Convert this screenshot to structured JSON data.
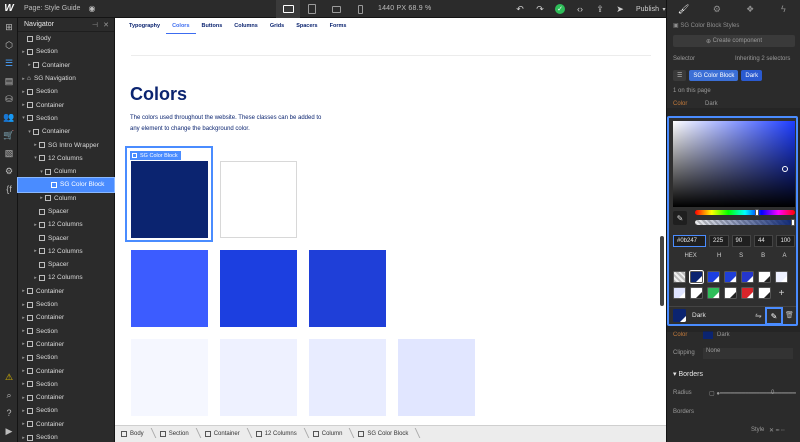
{
  "topbar": {
    "logo": "W",
    "page_label": "Page: Style Guide",
    "size_readout": "1440 PX  68.9 %",
    "publish_label": "Publish"
  },
  "navigator": {
    "title": "Navigator",
    "rows": [
      {
        "label": "Body",
        "indent": 0,
        "caret": "",
        "icon": "box"
      },
      {
        "label": "Section",
        "indent": 0,
        "caret": "▸",
        "icon": "box"
      },
      {
        "label": "Container",
        "indent": 1,
        "caret": "▸",
        "icon": "box"
      },
      {
        "label": "SG Navigation",
        "indent": 0,
        "caret": "▸",
        "icon": "component"
      },
      {
        "label": "Section",
        "indent": 0,
        "caret": "▸",
        "icon": "box"
      },
      {
        "label": "Container",
        "indent": 0,
        "caret": "▸",
        "icon": "box"
      },
      {
        "label": "Section",
        "indent": 0,
        "caret": "▾",
        "icon": "box"
      },
      {
        "label": "Container",
        "indent": 1,
        "caret": "▾",
        "icon": "box"
      },
      {
        "label": "SG Intro Wrapper",
        "indent": 2,
        "caret": "▸",
        "icon": "box"
      },
      {
        "label": "12 Columns",
        "indent": 2,
        "caret": "▾",
        "icon": "box"
      },
      {
        "label": "Column",
        "indent": 3,
        "caret": "▾",
        "icon": "box"
      },
      {
        "label": "SG Color Block",
        "indent": 4,
        "caret": "",
        "icon": "box",
        "selected": true
      },
      {
        "label": "Column",
        "indent": 3,
        "caret": "▸",
        "icon": "box"
      },
      {
        "label": "Spacer",
        "indent": 2,
        "caret": "",
        "icon": "box"
      },
      {
        "label": "12 Columns",
        "indent": 2,
        "caret": "▸",
        "icon": "box"
      },
      {
        "label": "Spacer",
        "indent": 2,
        "caret": "",
        "icon": "box"
      },
      {
        "label": "12 Columns",
        "indent": 2,
        "caret": "▸",
        "icon": "box"
      },
      {
        "label": "Spacer",
        "indent": 2,
        "caret": "",
        "icon": "box"
      },
      {
        "label": "12 Columns",
        "indent": 2,
        "caret": "▸",
        "icon": "box"
      },
      {
        "label": "Container",
        "indent": 0,
        "caret": "▸",
        "icon": "box"
      },
      {
        "label": "Section",
        "indent": 0,
        "caret": "▸",
        "icon": "box"
      },
      {
        "label": "Container",
        "indent": 0,
        "caret": "▸",
        "icon": "box"
      },
      {
        "label": "Section",
        "indent": 0,
        "caret": "▸",
        "icon": "box"
      },
      {
        "label": "Container",
        "indent": 0,
        "caret": "▸",
        "icon": "box"
      },
      {
        "label": "Section",
        "indent": 0,
        "caret": "▸",
        "icon": "box"
      },
      {
        "label": "Container",
        "indent": 0,
        "caret": "▸",
        "icon": "box"
      },
      {
        "label": "Section",
        "indent": 0,
        "caret": "▸",
        "icon": "box"
      },
      {
        "label": "Container",
        "indent": 0,
        "caret": "▸",
        "icon": "box"
      },
      {
        "label": "Section",
        "indent": 0,
        "caret": "▸",
        "icon": "box"
      },
      {
        "label": "Container",
        "indent": 0,
        "caret": "▸",
        "icon": "box"
      },
      {
        "label": "Section",
        "indent": 0,
        "caret": "▸",
        "icon": "box"
      }
    ]
  },
  "canvas": {
    "tabs": [
      {
        "label": "Typography",
        "active": false
      },
      {
        "label": "Colors",
        "active": true
      },
      {
        "label": "Buttons",
        "active": false
      },
      {
        "label": "Columns",
        "active": false
      },
      {
        "label": "Grids",
        "active": false
      },
      {
        "label": "Spacers",
        "active": false
      },
      {
        "label": "Forms",
        "active": false
      }
    ],
    "heading": "Colors",
    "description": "The colors used throughout the website. These classes can be added to any element to change the background color.",
    "selected_label": "SG Color Block",
    "swatch_rows": [
      [
        "#0b2470",
        "#ffffff"
      ],
      [
        "#3c5cff",
        "#1c3fe0",
        "#1f3fd8"
      ],
      [
        "#f5f7ff",
        "#eef1ff",
        "#e8ecff",
        "#e1e6ff"
      ]
    ]
  },
  "breadcrumbs": [
    "Body",
    "Section",
    "Container",
    "12 Columns",
    "Column",
    "SG Color Block"
  ],
  "right_panel": {
    "title": "SG Color Block Styles",
    "create_component": "Create component",
    "selector_label": "Selector",
    "inheriting": "Inheriting 2 selectors",
    "selector_chips": [
      "SG Color Block",
      "Dark"
    ],
    "on_this_page": "1 on this page",
    "color_label": "Color",
    "color_value": "Dark",
    "clipping_label": "Clipping",
    "clipping_value": "None",
    "borders_title": "Borders",
    "radius_label": "Radius",
    "radius_value": "0",
    "borders_label": "Borders",
    "style_label": "Style"
  },
  "color_picker": {
    "hex": "#0b247",
    "h": "225",
    "s": "90",
    "b": "44",
    "a": "100",
    "labels": [
      "HEX",
      "H",
      "S",
      "B",
      "A"
    ],
    "swatches": [
      "checker",
      "#0b2470",
      "#1c3fe0",
      "#1f3fd8",
      "#2436cc",
      "#ffffff",
      "#eef1ff",
      "#dfe4ff",
      "#ffffff",
      "#2ebd59",
      "#ffffff",
      "#d9252a",
      "#ffffff"
    ],
    "swatch_name": "Dark",
    "accent": "#4a8cff"
  }
}
